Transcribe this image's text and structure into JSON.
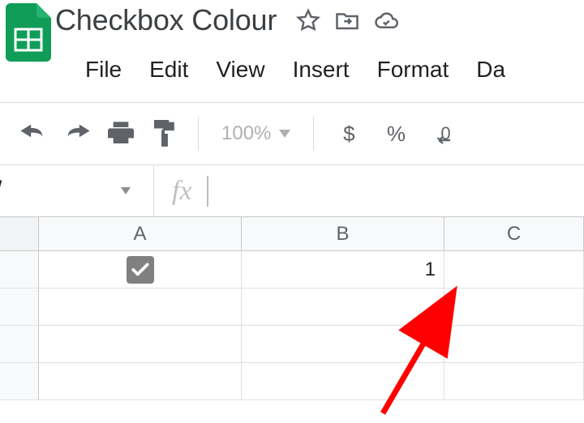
{
  "header": {
    "title": "Checkbox Colour",
    "icons": {
      "star": "star-outline-icon",
      "move": "move-to-folder-icon",
      "cloud": "cloud-saved-icon"
    }
  },
  "menu": {
    "file": "File",
    "edit": "Edit",
    "view": "View",
    "insert": "Insert",
    "format": "Format",
    "data": "Da"
  },
  "toolbar": {
    "undo": "undo-icon",
    "redo": "redo-icon",
    "print": "print-icon",
    "paint": "paint-format-icon",
    "zoom": "100%",
    "currency": "$",
    "percent": "%",
    "decrease_decimal": ".0"
  },
  "formula_bar": {
    "namebox_value": "",
    "fx_label": "fx",
    "formula_value": ""
  },
  "sheet": {
    "columns": [
      "A",
      "B",
      "C"
    ],
    "row_headers": [
      "",
      "",
      "",
      ""
    ],
    "cells": {
      "A1": {
        "type": "checkbox",
        "checked": true
      },
      "B1": "1"
    }
  },
  "colors": {
    "brand_green": "#0f9d58",
    "border": "#dadce0",
    "icon": "#5f6368",
    "arrow": "#ff0000"
  }
}
